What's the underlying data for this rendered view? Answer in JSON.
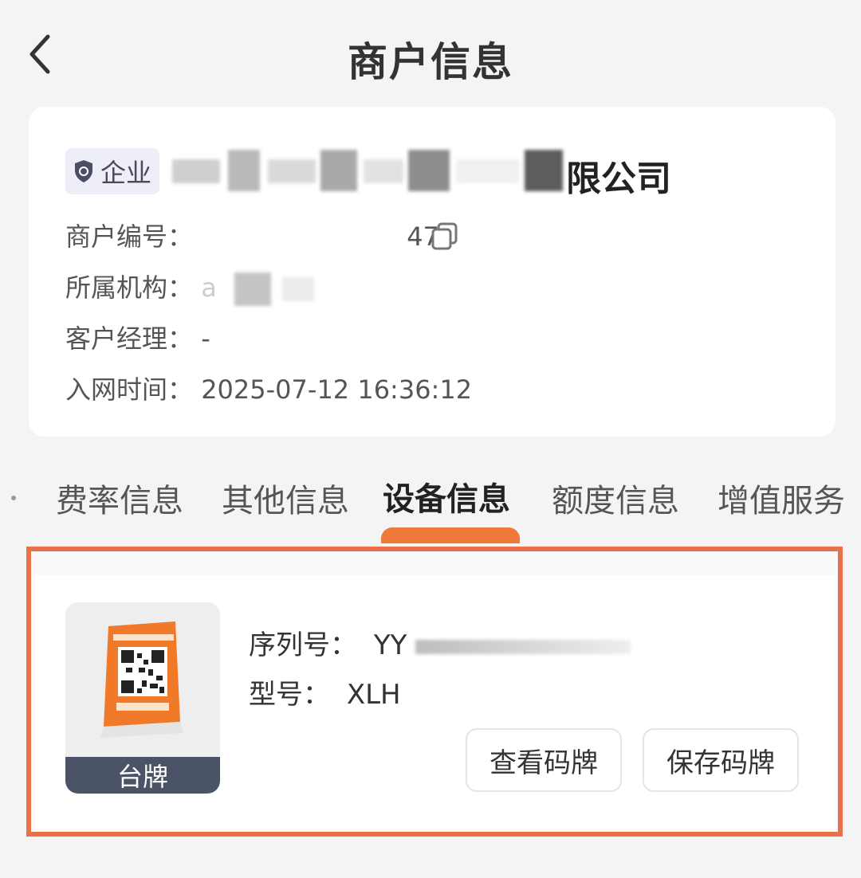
{
  "header": {
    "title": "商户信息"
  },
  "merchant": {
    "badge_label": "企业",
    "company_name_suffix": "限公司",
    "fields": {
      "merchant_no_label": "商户编号：",
      "merchant_no_value": "47",
      "institution_label": "所属机构：",
      "institution_value": "a",
      "manager_label": "客户经理：",
      "manager_value": "-",
      "join_time_label": "入网时间：",
      "join_time_value": "2025-07-12 16:36:12"
    }
  },
  "tabs": [
    {
      "label": "费率信息",
      "active": false
    },
    {
      "label": "其他信息",
      "active": false
    },
    {
      "label": "设备信息",
      "active": true
    },
    {
      "label": "额度信息",
      "active": false
    },
    {
      "label": "增值服务",
      "active": false
    }
  ],
  "device": {
    "thumb_caption": "台牌",
    "serial_label": "序列号：",
    "serial_value": "YY",
    "model_label": "型号：",
    "model_value": "XLH",
    "view_button": "查看码牌",
    "save_button": "保存码牌"
  },
  "colors": {
    "accent": "#f07a3a",
    "highlight_border": "#e8714a",
    "thumb_caption_bg": "#4b5466"
  }
}
